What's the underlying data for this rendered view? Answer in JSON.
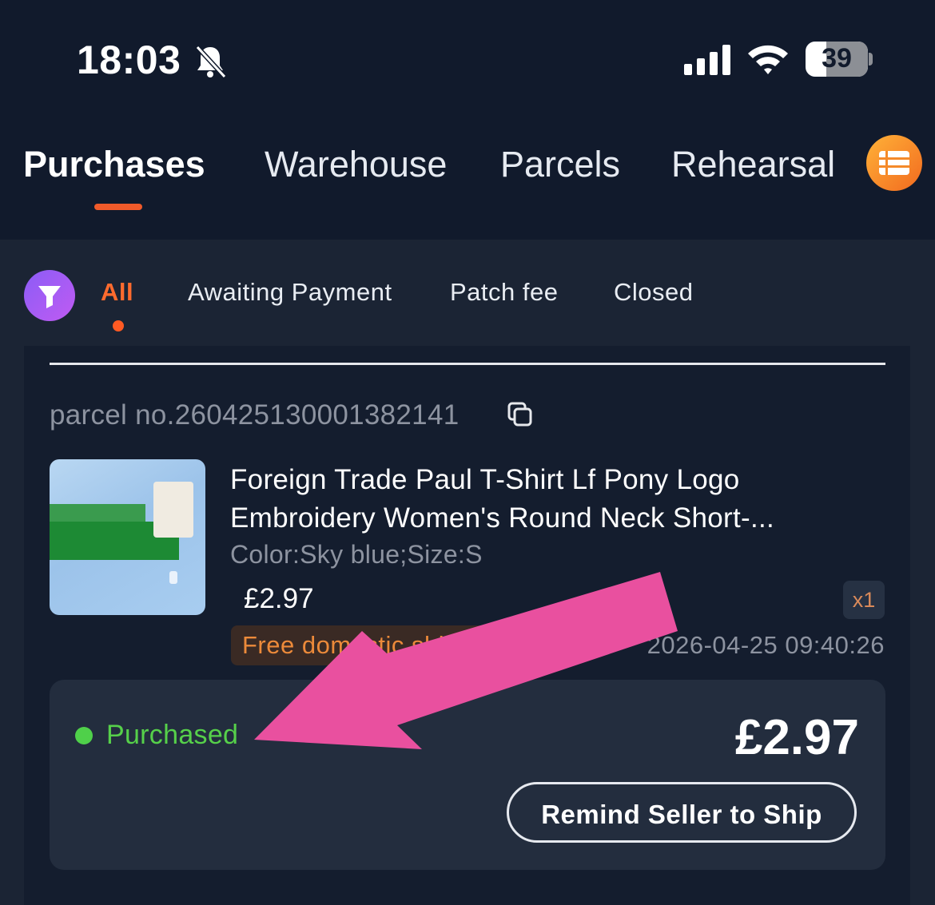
{
  "status_bar": {
    "time": "18:03",
    "battery": "39",
    "icons": [
      "bell-slash-icon",
      "signal-icon",
      "wifi-icon",
      "battery-icon"
    ]
  },
  "main_tabs": [
    {
      "label": "Purchases",
      "active": true
    },
    {
      "label": "Warehouse",
      "active": false
    },
    {
      "label": "Parcels",
      "active": false
    },
    {
      "label": "Rehearsal",
      "active": false
    }
  ],
  "menu_icon": "list-icon",
  "filter_icon": "filter-icon",
  "sub_tabs": [
    {
      "label": "All",
      "active": true
    },
    {
      "label": "Awaiting Payment",
      "active": false
    },
    {
      "label": "Patch fee",
      "active": false
    },
    {
      "label": "Closed",
      "active": false
    }
  ],
  "order": {
    "parcel_no": "parcel no.260425130001382141",
    "copy_icon": "copy-icon",
    "product_title": "Foreign Trade Paul T-Shirt Lf Pony Logo Embroidery Women's Round Neck Short-...",
    "spec": "Color:Sky blue;Size:S",
    "price": "£2.97",
    "quantity": "x1",
    "badge": "Free domestic shipping",
    "datetime": "2026-04-25 09:40:26",
    "status": "Purchased",
    "total": "£2.97",
    "remind_button": "Remind Seller to Ship"
  },
  "colors": {
    "accent": "#f05a2a",
    "status_green": "#56d04a",
    "annotation_arrow": "#e9509f"
  }
}
